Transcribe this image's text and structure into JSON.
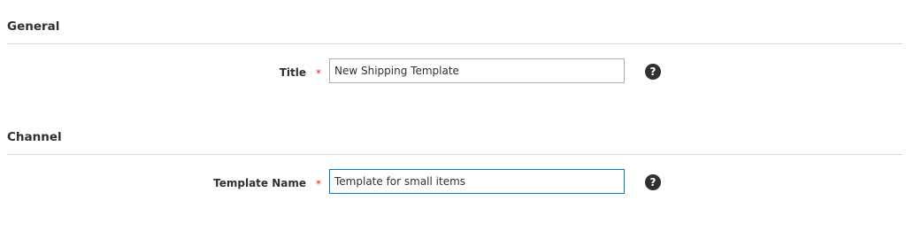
{
  "sections": [
    {
      "title": "General",
      "field": {
        "label": "Title",
        "required_mark": "*",
        "value": "New Shipping Template",
        "help_icon": "?"
      }
    },
    {
      "title": "Channel",
      "field": {
        "label": "Template Name",
        "required_mark": "*",
        "value": "Template for small items",
        "help_icon": "?"
      }
    }
  ],
  "colors": {
    "text": "#303030",
    "required": "#e22626",
    "focus_border": "#007bdb",
    "input_border": "#adadad",
    "rule": "#d6d6d6"
  }
}
